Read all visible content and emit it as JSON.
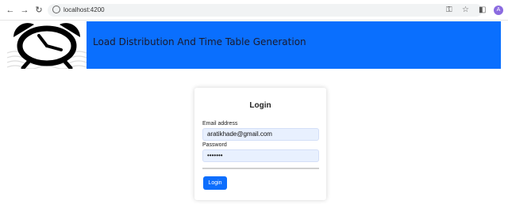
{
  "browser": {
    "back_icon": "←",
    "forward_icon": "→",
    "reload_icon": "↻",
    "url": "localhost:4200",
    "key_icon": "⚿",
    "star_icon": "☆",
    "sidepanel_icon": "◧",
    "profile_initial": "A"
  },
  "header": {
    "title": "Load Distribution And Time Table Generation",
    "background": "#0a6ffe"
  },
  "login": {
    "title": "Login",
    "email_label": "Email address",
    "email_value": "aratikhade@gmail.com",
    "password_label": "Password",
    "password_value": "•••••••",
    "button_label": "Login",
    "button_color": "#0d6efd"
  }
}
